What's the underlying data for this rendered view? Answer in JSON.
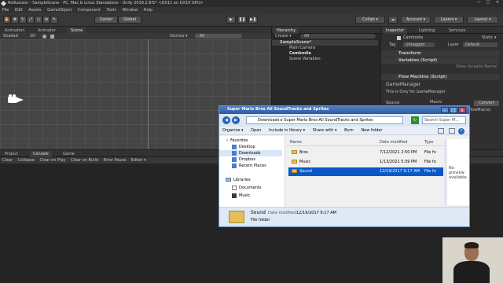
{
  "window": {
    "title": "RollLesson - SampleScene - PC, Mac & Linux Standalone - Unity 2019.2.6f1* <DX11 on DX10 GPU>",
    "controls": [
      "—",
      "□",
      "✕"
    ]
  },
  "menu": [
    "File",
    "Edit",
    "Assets",
    "GameObject",
    "Component",
    "Tools",
    "Window",
    "Help"
  ],
  "toolbar": {
    "pivot_center": "Center",
    "global": "Global",
    "collab": "Collab ▾",
    "account": "Account ▾",
    "layers": "Layers ▾",
    "layout": "Layout ▾"
  },
  "left_tabs": [
    "Animation",
    "Animator",
    "Scene"
  ],
  "scene": {
    "shading": "Shaded",
    "mode": "2D",
    "gizmos": "Gizmos ▾",
    "search": "All"
  },
  "hierarchy": {
    "tab": "Hierarchy",
    "create": "Create ▾",
    "search": "All",
    "rows": [
      {
        "label": "SampleScene*",
        "indent": 0,
        "bold": true
      },
      {
        "label": "Main Camera",
        "indent": 1,
        "bold": false
      },
      {
        "label": "Cambodia",
        "indent": 1,
        "bold": true
      },
      {
        "label": "Scene Variables",
        "indent": 1,
        "bold": false
      }
    ]
  },
  "inspector": {
    "tabs": [
      "Inspector",
      "Lighting",
      "Services"
    ],
    "object_name": "Cambodia",
    "static": "Static ▾",
    "tag_label": "Tag",
    "tag_value": "Untagged",
    "layer_label": "Layer",
    "layer_value": "Default",
    "components": [
      "Transform",
      "Variables (Script)",
      "Flow Machine (Script)"
    ],
    "new_variable": "(New Variable Name)",
    "flow_title": "GameManager",
    "flow_desc": "This is Only for GameManager",
    "source_label": "Source",
    "source_value": "Macro",
    "convert": "Convert",
    "macro_value": "flowMacro)"
  },
  "bottom": {
    "tabs": [
      "Project",
      "Console",
      "Game"
    ],
    "console_buttons": [
      "Clear",
      "Collapse",
      "Clear on Play",
      "Clear on Build",
      "Error Pause",
      "Editor ▾"
    ]
  },
  "explorer": {
    "title": "Super Mario Bros All SoundTracks and Sprites",
    "address": [
      "Downloads",
      "Super Mario Bros All SoundTracks and Sprites"
    ],
    "search_placeholder": "Search Super M...",
    "commands": [
      "Organize ▾",
      "Open",
      "Include in library ▾",
      "Share with ▾",
      "Burn",
      "New folder"
    ],
    "nav": {
      "favorites_header": "Favorites",
      "favorites": [
        "Desktop",
        "Downloads",
        "Dropbox",
        "Recent Places"
      ],
      "libraries_header": "Libraries",
      "libraries": [
        "Documents",
        "Music"
      ]
    },
    "columns": [
      "Name",
      "Date modified",
      "Type"
    ],
    "files": [
      {
        "name": "Bros",
        "date": "7/12/2021 2:50 PM",
        "type": "File fo",
        "selected": false
      },
      {
        "name": "Music",
        "date": "1/13/2021 5:39 PM",
        "type": "File fo",
        "selected": false
      },
      {
        "name": "Sound",
        "date": "12/19/2017 9:17 AM",
        "type": "File fo",
        "selected": true
      }
    ],
    "preview": "No preview available.",
    "details": {
      "name": "Sound",
      "date_label": "Date modified:",
      "date": "12/19/2017 9:17 AM",
      "type": "File folder"
    }
  },
  "colors": {
    "unity_bg": "#282828",
    "scene_bg": "#444444",
    "selection": "#0a58c8",
    "explorer_title": "#2d5aa0"
  }
}
